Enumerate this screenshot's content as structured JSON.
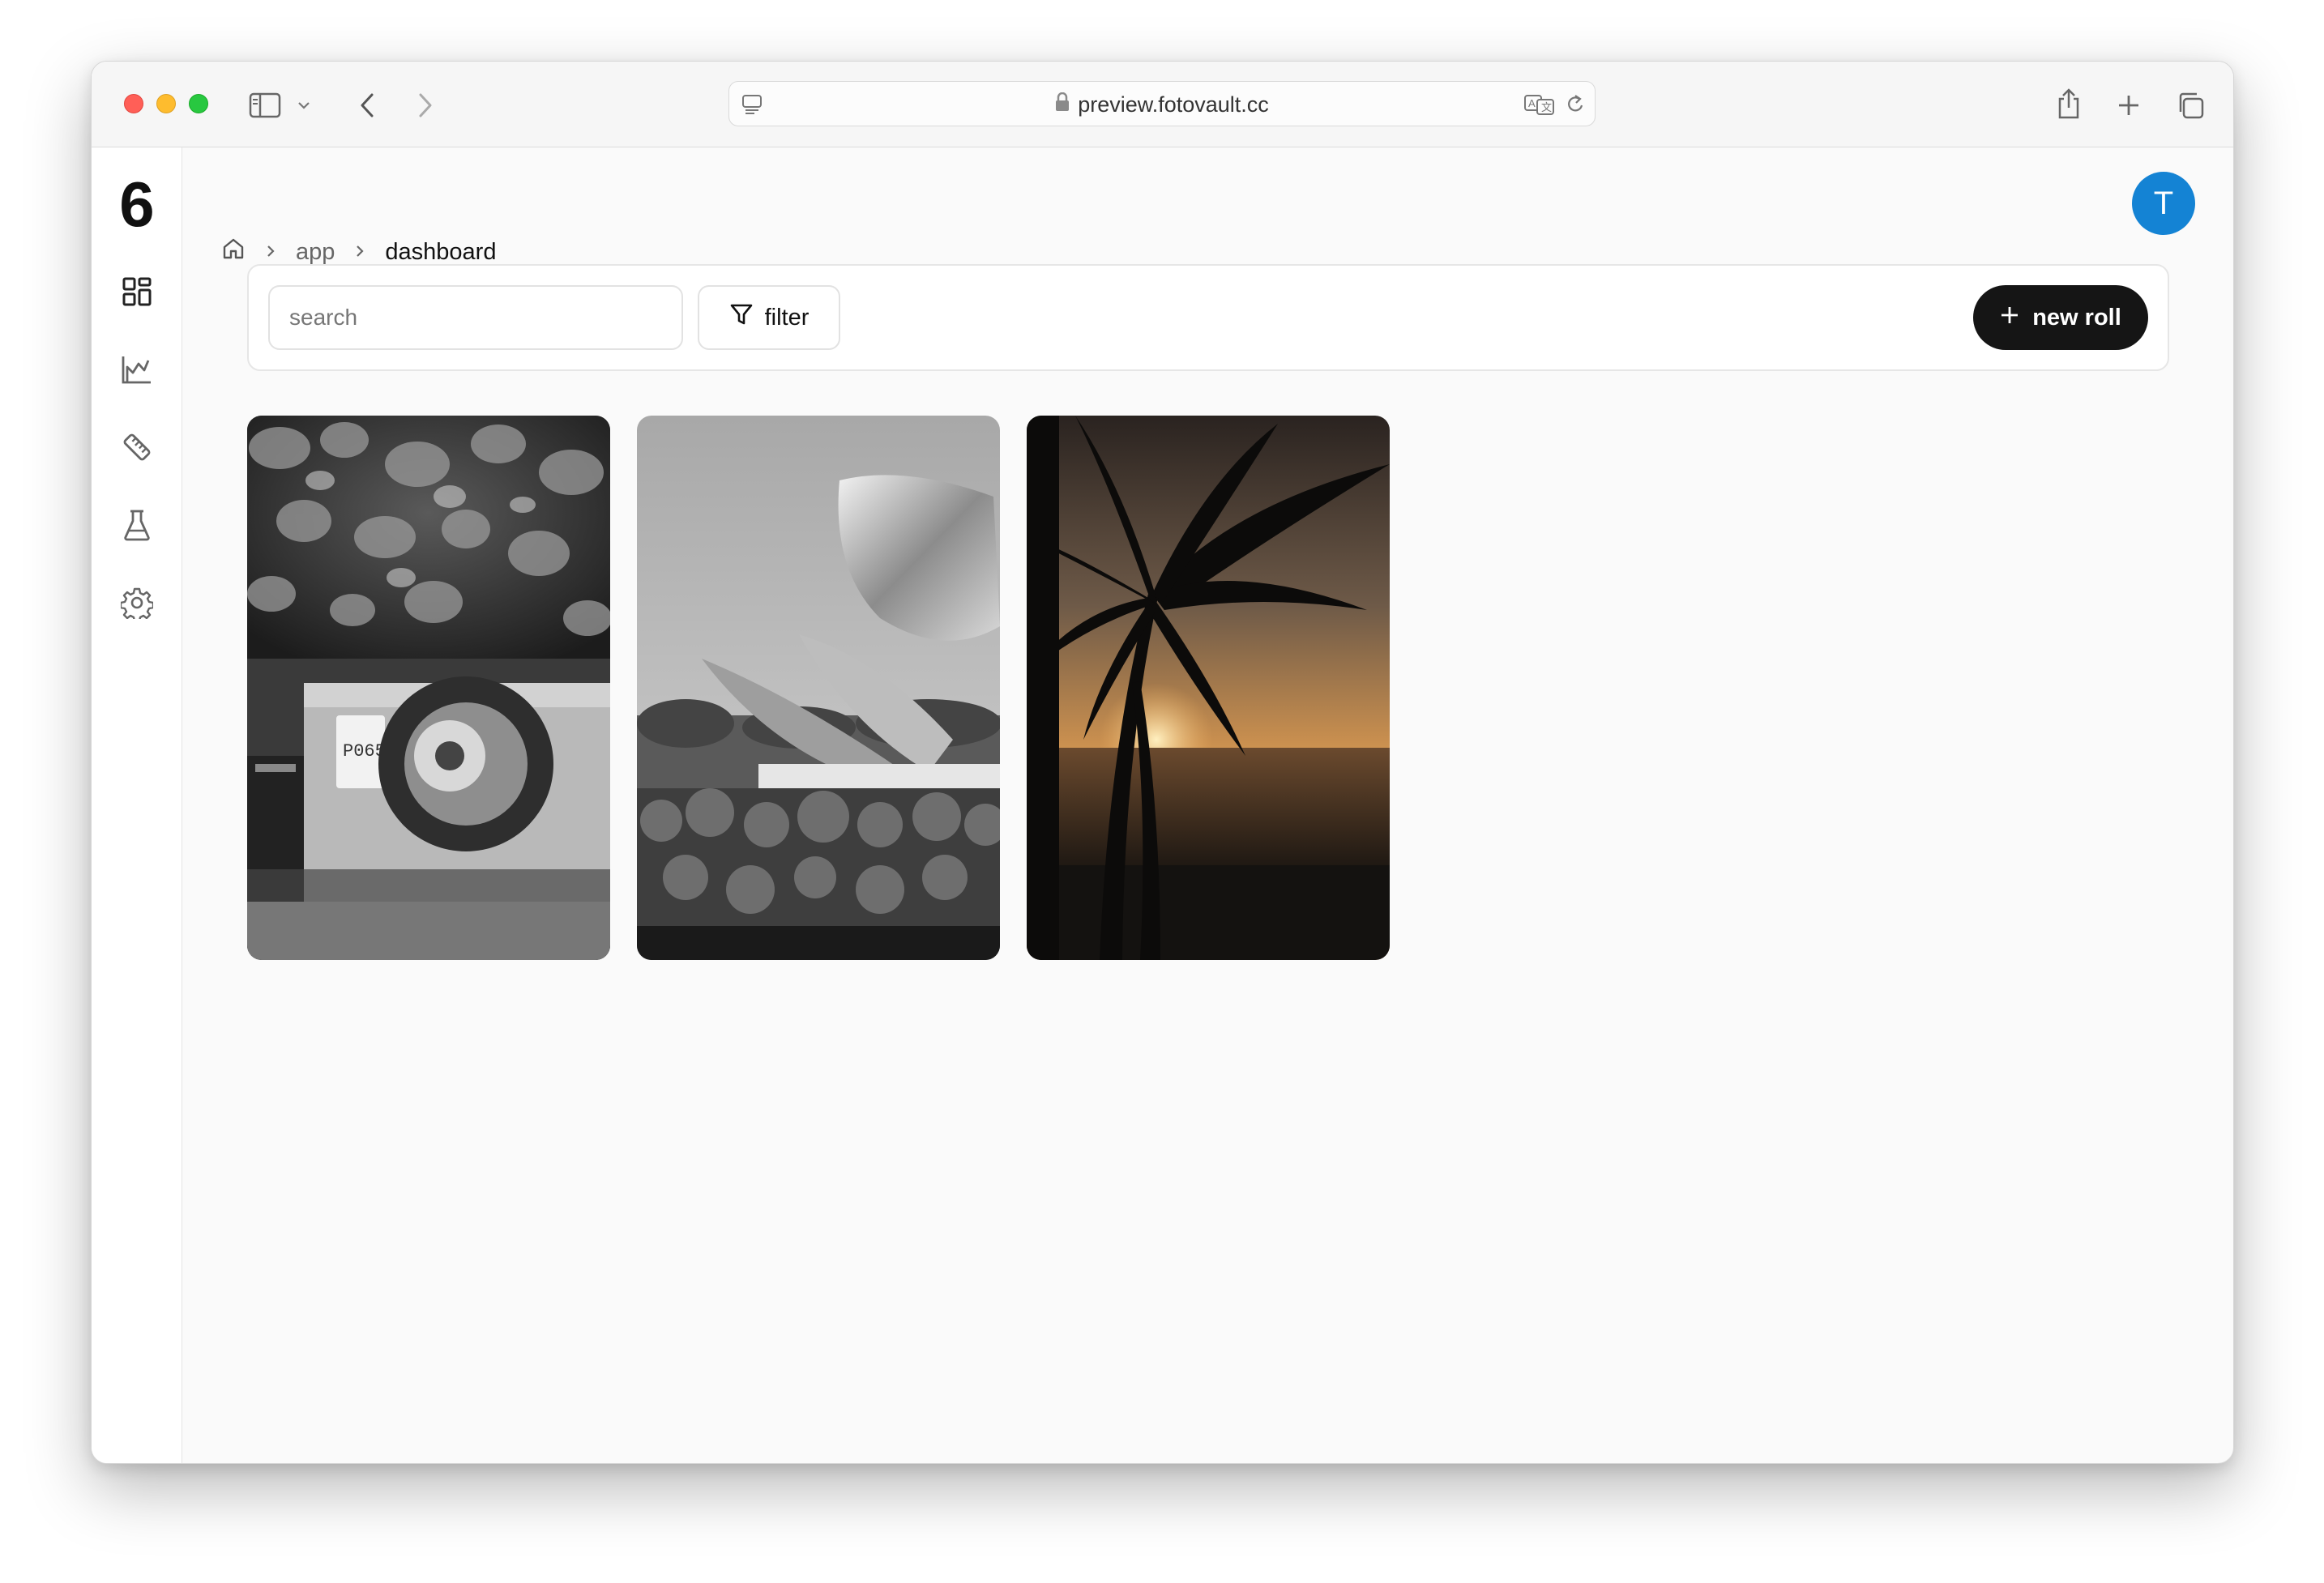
{
  "browser": {
    "url": "preview.fotovault.cc"
  },
  "sidebar": {
    "logo": "6",
    "items": [
      {
        "icon": "dashboard-grid-icon"
      },
      {
        "icon": "chart-icon"
      },
      {
        "icon": "ruler-icon"
      },
      {
        "icon": "flask-icon"
      },
      {
        "icon": "gear-icon"
      }
    ]
  },
  "breadcrumb": {
    "items": [
      "app",
      "dashboard"
    ]
  },
  "user": {
    "avatar_initial": "T",
    "avatar_color": "#1483d4"
  },
  "toolbar": {
    "search_placeholder": "search",
    "filter_label": "filter",
    "new_roll_label": "new roll"
  },
  "rolls": [
    {
      "subject": "vintage jeep spare tire under vine leaves",
      "tone": "black-and-white"
    },
    {
      "subject": "metal flower sculpture over hedge",
      "tone": "black-and-white"
    },
    {
      "subject": "palm tree silhouette at ocean sunset",
      "tone": "color"
    }
  ]
}
